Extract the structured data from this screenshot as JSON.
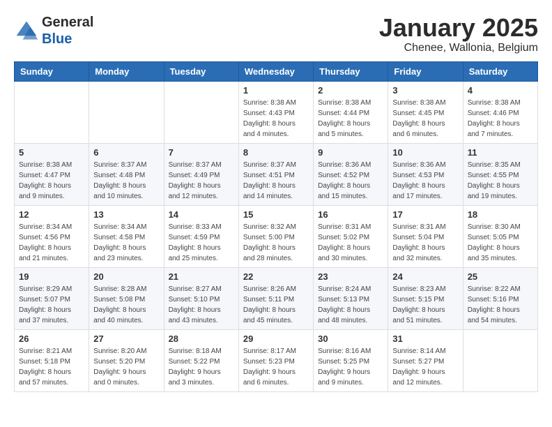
{
  "logo": {
    "line1": "General",
    "line2": "Blue"
  },
  "title": "January 2025",
  "subtitle": "Chenee, Wallonia, Belgium",
  "weekdays": [
    "Sunday",
    "Monday",
    "Tuesday",
    "Wednesday",
    "Thursday",
    "Friday",
    "Saturday"
  ],
  "weeks": [
    [
      {
        "day": "",
        "content": ""
      },
      {
        "day": "",
        "content": ""
      },
      {
        "day": "",
        "content": ""
      },
      {
        "day": "1",
        "content": "Sunrise: 8:38 AM\nSunset: 4:43 PM\nDaylight: 8 hours\nand 4 minutes."
      },
      {
        "day": "2",
        "content": "Sunrise: 8:38 AM\nSunset: 4:44 PM\nDaylight: 8 hours\nand 5 minutes."
      },
      {
        "day": "3",
        "content": "Sunrise: 8:38 AM\nSunset: 4:45 PM\nDaylight: 8 hours\nand 6 minutes."
      },
      {
        "day": "4",
        "content": "Sunrise: 8:38 AM\nSunset: 4:46 PM\nDaylight: 8 hours\nand 7 minutes."
      }
    ],
    [
      {
        "day": "5",
        "content": "Sunrise: 8:38 AM\nSunset: 4:47 PM\nDaylight: 8 hours\nand 9 minutes."
      },
      {
        "day": "6",
        "content": "Sunrise: 8:37 AM\nSunset: 4:48 PM\nDaylight: 8 hours\nand 10 minutes."
      },
      {
        "day": "7",
        "content": "Sunrise: 8:37 AM\nSunset: 4:49 PM\nDaylight: 8 hours\nand 12 minutes."
      },
      {
        "day": "8",
        "content": "Sunrise: 8:37 AM\nSunset: 4:51 PM\nDaylight: 8 hours\nand 14 minutes."
      },
      {
        "day": "9",
        "content": "Sunrise: 8:36 AM\nSunset: 4:52 PM\nDaylight: 8 hours\nand 15 minutes."
      },
      {
        "day": "10",
        "content": "Sunrise: 8:36 AM\nSunset: 4:53 PM\nDaylight: 8 hours\nand 17 minutes."
      },
      {
        "day": "11",
        "content": "Sunrise: 8:35 AM\nSunset: 4:55 PM\nDaylight: 8 hours\nand 19 minutes."
      }
    ],
    [
      {
        "day": "12",
        "content": "Sunrise: 8:34 AM\nSunset: 4:56 PM\nDaylight: 8 hours\nand 21 minutes."
      },
      {
        "day": "13",
        "content": "Sunrise: 8:34 AM\nSunset: 4:58 PM\nDaylight: 8 hours\nand 23 minutes."
      },
      {
        "day": "14",
        "content": "Sunrise: 8:33 AM\nSunset: 4:59 PM\nDaylight: 8 hours\nand 25 minutes."
      },
      {
        "day": "15",
        "content": "Sunrise: 8:32 AM\nSunset: 5:00 PM\nDaylight: 8 hours\nand 28 minutes."
      },
      {
        "day": "16",
        "content": "Sunrise: 8:31 AM\nSunset: 5:02 PM\nDaylight: 8 hours\nand 30 minutes."
      },
      {
        "day": "17",
        "content": "Sunrise: 8:31 AM\nSunset: 5:04 PM\nDaylight: 8 hours\nand 32 minutes."
      },
      {
        "day": "18",
        "content": "Sunrise: 8:30 AM\nSunset: 5:05 PM\nDaylight: 8 hours\nand 35 minutes."
      }
    ],
    [
      {
        "day": "19",
        "content": "Sunrise: 8:29 AM\nSunset: 5:07 PM\nDaylight: 8 hours\nand 37 minutes."
      },
      {
        "day": "20",
        "content": "Sunrise: 8:28 AM\nSunset: 5:08 PM\nDaylight: 8 hours\nand 40 minutes."
      },
      {
        "day": "21",
        "content": "Sunrise: 8:27 AM\nSunset: 5:10 PM\nDaylight: 8 hours\nand 43 minutes."
      },
      {
        "day": "22",
        "content": "Sunrise: 8:26 AM\nSunset: 5:11 PM\nDaylight: 8 hours\nand 45 minutes."
      },
      {
        "day": "23",
        "content": "Sunrise: 8:24 AM\nSunset: 5:13 PM\nDaylight: 8 hours\nand 48 minutes."
      },
      {
        "day": "24",
        "content": "Sunrise: 8:23 AM\nSunset: 5:15 PM\nDaylight: 8 hours\nand 51 minutes."
      },
      {
        "day": "25",
        "content": "Sunrise: 8:22 AM\nSunset: 5:16 PM\nDaylight: 8 hours\nand 54 minutes."
      }
    ],
    [
      {
        "day": "26",
        "content": "Sunrise: 8:21 AM\nSunset: 5:18 PM\nDaylight: 8 hours\nand 57 minutes."
      },
      {
        "day": "27",
        "content": "Sunrise: 8:20 AM\nSunset: 5:20 PM\nDaylight: 9 hours\nand 0 minutes."
      },
      {
        "day": "28",
        "content": "Sunrise: 8:18 AM\nSunset: 5:22 PM\nDaylight: 9 hours\nand 3 minutes."
      },
      {
        "day": "29",
        "content": "Sunrise: 8:17 AM\nSunset: 5:23 PM\nDaylight: 9 hours\nand 6 minutes."
      },
      {
        "day": "30",
        "content": "Sunrise: 8:16 AM\nSunset: 5:25 PM\nDaylight: 9 hours\nand 9 minutes."
      },
      {
        "day": "31",
        "content": "Sunrise: 8:14 AM\nSunset: 5:27 PM\nDaylight: 9 hours\nand 12 minutes."
      },
      {
        "day": "",
        "content": ""
      }
    ]
  ]
}
